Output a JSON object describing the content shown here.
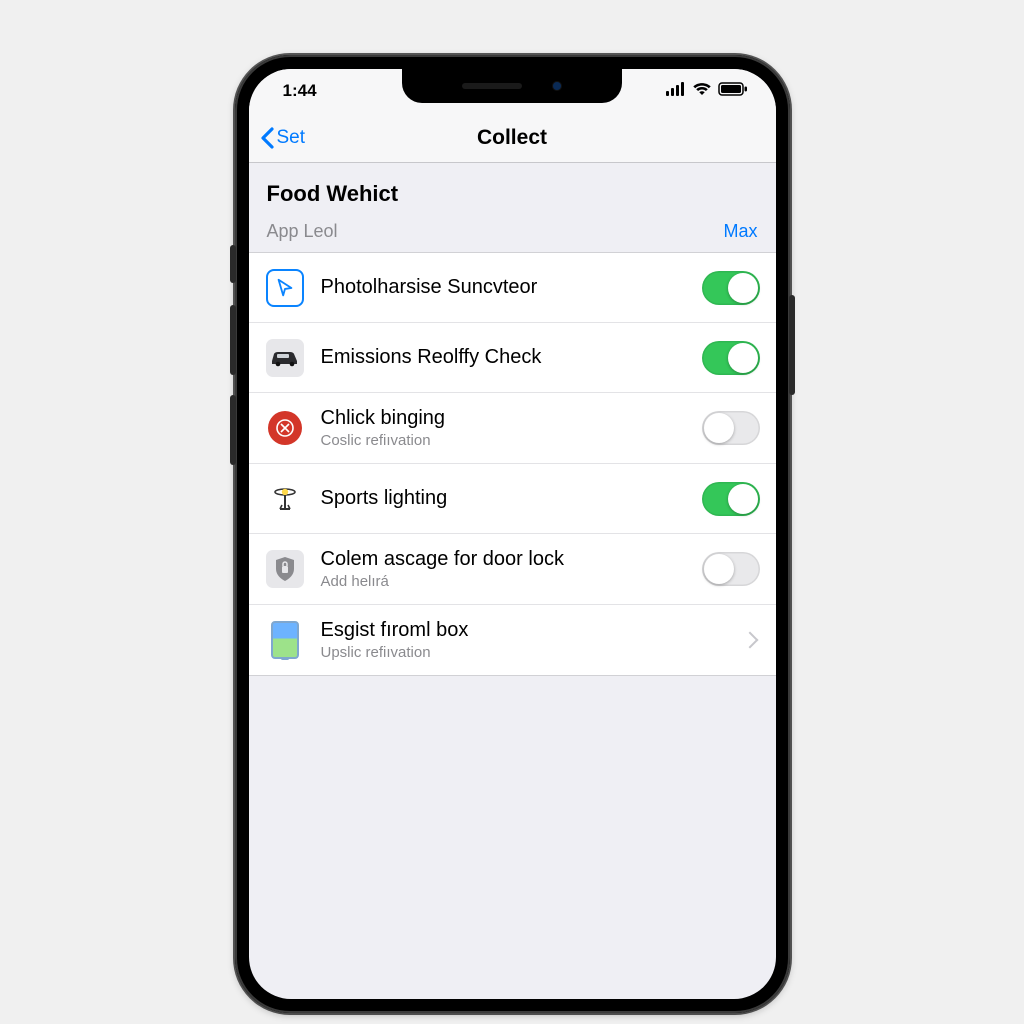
{
  "status": {
    "time": "1:44"
  },
  "nav": {
    "back": "Set",
    "title": "Collect"
  },
  "section": {
    "title": "Food Wehict"
  },
  "subheader": {
    "left": "App Leol",
    "right": "Max"
  },
  "rows": [
    {
      "label": "Photolharsise Suncvteor",
      "sub": "",
      "toggle": "on",
      "acc": "switch"
    },
    {
      "label": "Emissions Reolffy Check",
      "sub": "",
      "toggle": "on",
      "acc": "switch"
    },
    {
      "label": "Chlick binging",
      "sub": "Coslic refiıvation",
      "toggle": "off",
      "acc": "switch"
    },
    {
      "label": "Sports lighting",
      "sub": "",
      "toggle": "on",
      "acc": "switch"
    },
    {
      "label": "Colem ascage for door lock",
      "sub": "Add helırá",
      "toggle": "off",
      "acc": "switch"
    },
    {
      "label": "Esgist fıroml box",
      "sub": "Upslic refiıvation",
      "toggle": "",
      "acc": "chevron"
    }
  ]
}
